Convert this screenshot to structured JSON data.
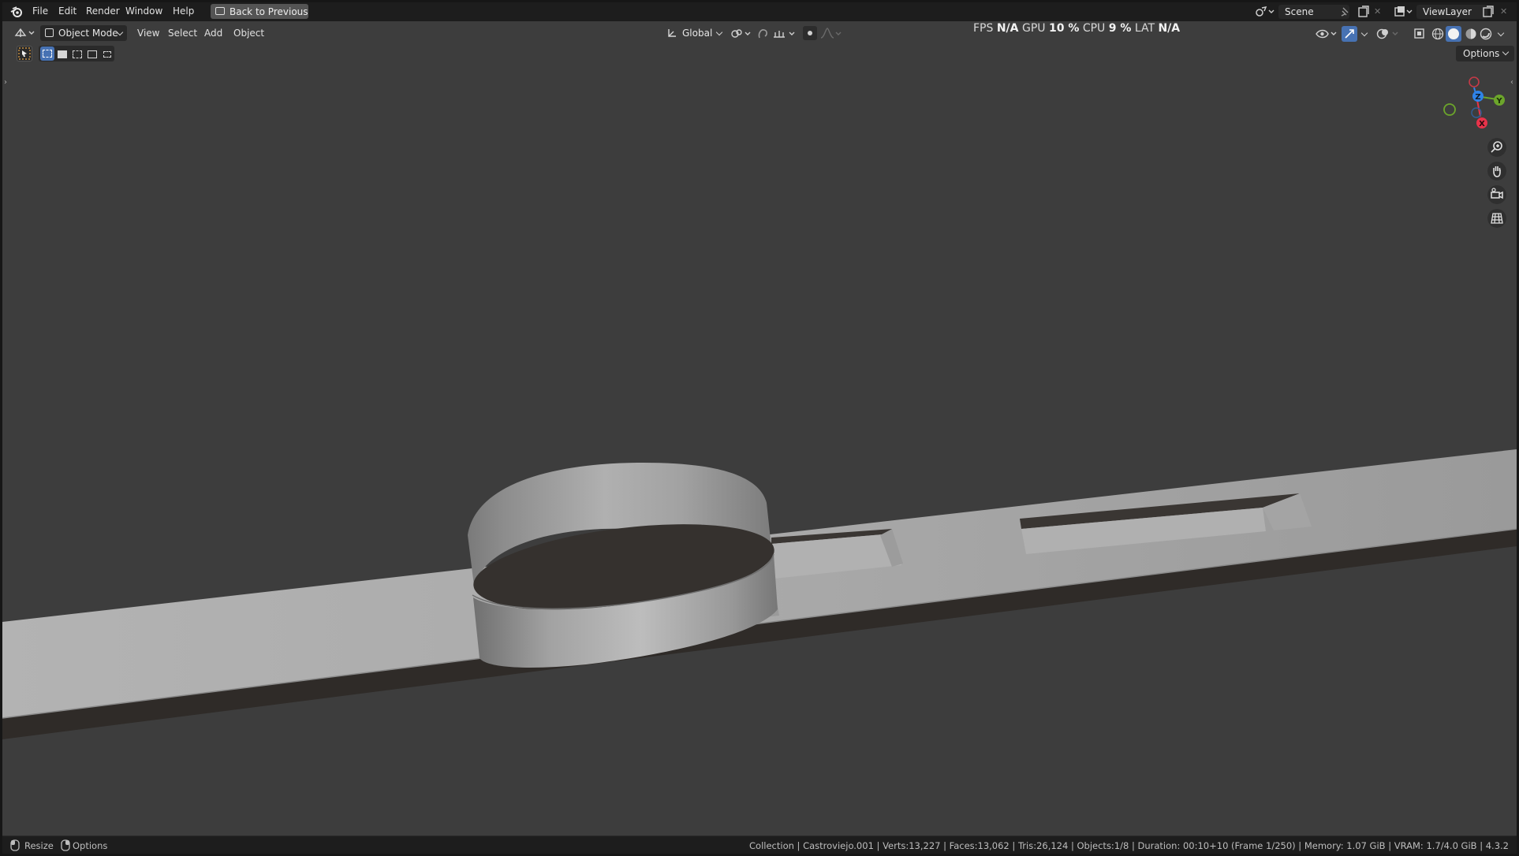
{
  "menu": {
    "items": [
      "File",
      "Edit",
      "Render",
      "Window",
      "Help"
    ],
    "back_button": "Back to Previous"
  },
  "scene": {
    "label": "Scene"
  },
  "view_layer": {
    "label": "ViewLayer"
  },
  "header": {
    "mode": "Object Mode",
    "view": "View",
    "select": "Select",
    "add": "Add",
    "object": "Object",
    "orientation": "Global"
  },
  "performance": {
    "fps_label": "FPS",
    "fps_value": "N/A",
    "gpu_label": "GPU",
    "gpu_value": "10 %",
    "cpu_label": "CPU",
    "cpu_value": "9 %",
    "lat_label": "LAT",
    "lat_value": "N/A"
  },
  "options_button": "Options",
  "gizmo": {
    "x": "X",
    "y": "Y",
    "z": "Z"
  },
  "status": {
    "resize": "Resize",
    "options": "Options",
    "info": "Collection | Castroviejo.001 | Verts:13,227 | Faces:13,062 | Tris:26,124 | Objects:1/8 | Duration: 00:10+10 (Frame 1/250) | Memory: 1.07 GiB | VRAM: 1.7/4.0 GiB | 4.3.2"
  },
  "colors": {
    "accent_blue": "#4772b3",
    "axis_x": "#e8334a",
    "axis_y": "#6ca52b",
    "axis_z": "#2f83e8",
    "viewport_bg": "#3d3d3d"
  },
  "icons": [
    "blender-logo-icon",
    "back-icon",
    "editor-type-icon",
    "object-mode-icon",
    "orientation-icon",
    "pivot-icon",
    "snap-icon",
    "proportional-icon",
    "scene-icon",
    "pin-icon",
    "viewlayer-icon",
    "select-box-icon",
    "zoom-icon",
    "hand-icon",
    "camera-icon",
    "grid-icon",
    "mouse-icon"
  ]
}
